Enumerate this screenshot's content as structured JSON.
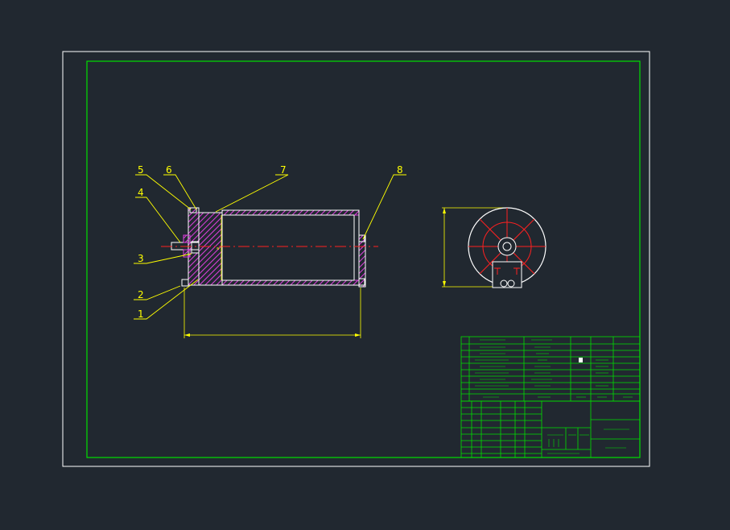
{
  "colors": {
    "background": "#212830",
    "paper_border": "#ffffff",
    "frame": "#00e000",
    "leader": "#ffff00",
    "part_outline": "#ffffff",
    "hatch": "#e040e0",
    "centerline": "#ff2020"
  },
  "balloons": [
    "5",
    "6",
    "7",
    "8",
    "4",
    "3",
    "2",
    "1"
  ]
}
